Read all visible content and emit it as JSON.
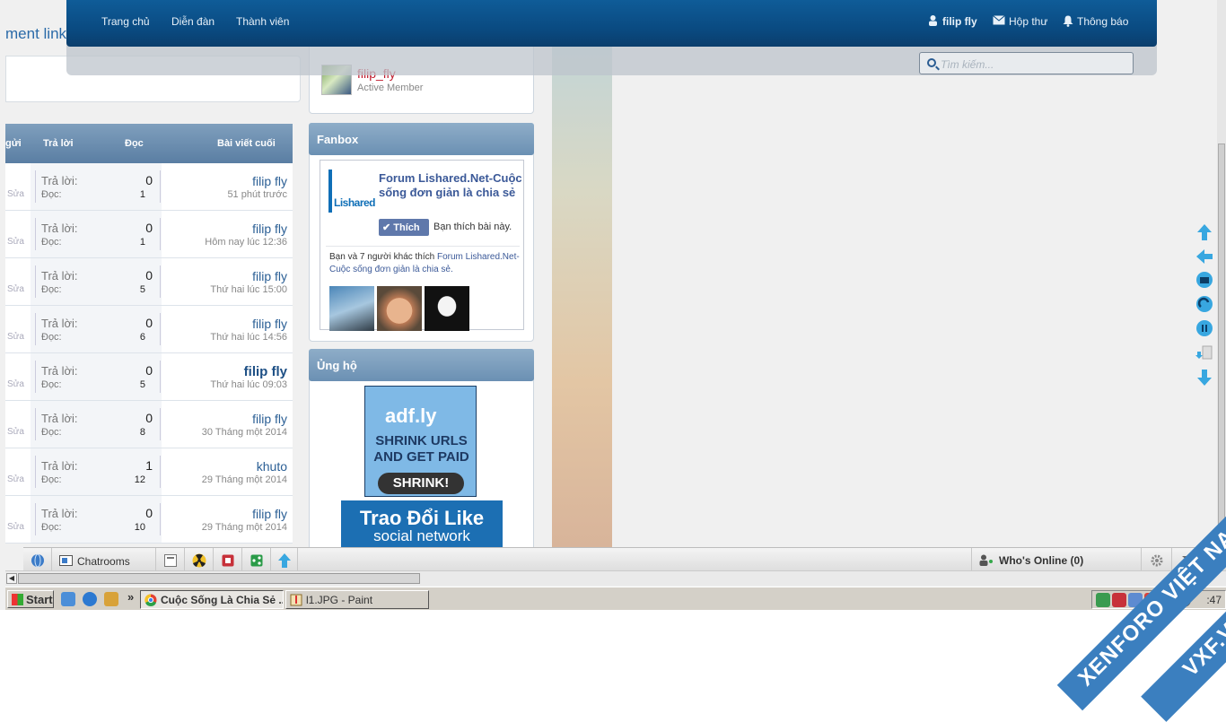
{
  "nav": {
    "items": [
      "Trang chủ",
      "Diễn đàn",
      "Thành viên"
    ],
    "user": "filip fly",
    "inbox": "Hộp thư",
    "alerts": "Thông báo"
  },
  "search": {
    "placeholder": "Tìm kiếm..."
  },
  "left": {
    "doc_link": "ment link",
    "headers": {
      "poster": "gửi",
      "replies": "Trả lời",
      "views": "Đọc",
      "last": "Bài viết cuối"
    },
    "reply_label": "Trả lời:",
    "view_label": "Đọc:",
    "edit_label": "Sửa",
    "threads": [
      {
        "replies": "0",
        "views": "1",
        "last_user": "filip fly",
        "last_time": "51 phút trước",
        "bold": false
      },
      {
        "replies": "0",
        "views": "1",
        "last_user": "filip fly",
        "last_time": "Hôm nay lúc 12:36",
        "bold": false
      },
      {
        "replies": "0",
        "views": "5",
        "last_user": "filip fly",
        "last_time": "Thứ hai lúc 15:00",
        "bold": false
      },
      {
        "replies": "0",
        "views": "6",
        "last_user": "filip fly",
        "last_time": "Thứ hai lúc 14:56",
        "bold": false
      },
      {
        "replies": "0",
        "views": "5",
        "last_user": "filip fly",
        "last_time": "Thứ hai lúc 09:03",
        "bold": true
      },
      {
        "replies": "0",
        "views": "8",
        "last_user": "filip fly",
        "last_time": "30 Tháng một 2014",
        "bold": false
      },
      {
        "replies": "1",
        "views": "12",
        "last_user": "khuto",
        "last_time": "29 Tháng một 2014",
        "bold": false
      },
      {
        "replies": "0",
        "views": "10",
        "last_user": "filip fly",
        "last_time": "29 Tháng một 2014",
        "bold": false
      }
    ]
  },
  "sidebar": {
    "member_name": "filip_fly",
    "member_role": "Active Member",
    "fanbox_title": "Fanbox",
    "fb_logo": "Lishared",
    "fb_page": "Forum Lishared.Net-Cuộc sống đơn giản là chia sẻ",
    "fb_like": "Thích",
    "fb_like_text": "Bạn thích bài này.",
    "fb_friends_prefix": "Bạn và 7 người khác thích ",
    "fb_friends_link": "Forum Lishared.Net-Cuộc sống đơn giản là chia sẻ.",
    "support_title": "Ủng hộ",
    "ad1_logo": "adf.ly",
    "ad1_line1": "SHRINK URLS",
    "ad1_line2": "AND GET PAID",
    "ad1_button": "SHRINK!",
    "ad2_line1": "Trao Đổi Like",
    "ad2_line2": "social network"
  },
  "chatbar": {
    "chatrooms": "Chatrooms",
    "whos_online": "Who's Online (0)"
  },
  "taskbar": {
    "start": "Start",
    "tasks": [
      "Cuộc Sống Là Chia Sẻ ...",
      "l1.JPG - Paint"
    ],
    "clock": ":47"
  },
  "watermark": {
    "line1": "XENFORO VIỆT NAM",
    "line2": "VXF.VN"
  },
  "colors": {
    "nav": "#0a4b82",
    "accent": "#2b5f95",
    "member": "#c0182a"
  }
}
